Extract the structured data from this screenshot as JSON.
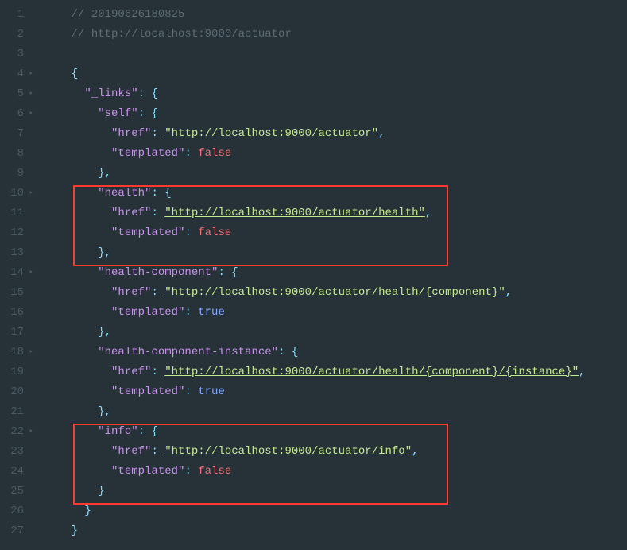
{
  "lines": {
    "l1": {
      "num": "1",
      "fold": "",
      "comment": "// 20190626180825"
    },
    "l2": {
      "num": "2",
      "fold": "",
      "comment": "// http://localhost:9000/actuator"
    },
    "l3": {
      "num": "3",
      "fold": ""
    },
    "l4": {
      "num": "4",
      "fold": "▾",
      "p1": "{"
    },
    "l5": {
      "num": "5",
      "fold": "▾",
      "k": "\"_links\"",
      "p1": ": ",
      "p2": "{"
    },
    "l6": {
      "num": "6",
      "fold": "▾",
      "k": "\"self\"",
      "p1": ": ",
      "p2": "{"
    },
    "l7": {
      "num": "7",
      "fold": "",
      "k": "\"href\"",
      "p1": ": ",
      "v": "\"http://localhost:9000/actuator\"",
      "p2": ","
    },
    "l8": {
      "num": "8",
      "fold": "",
      "k": "\"templated\"",
      "p1": ": ",
      "b": "false"
    },
    "l9": {
      "num": "9",
      "fold": "",
      "p1": "},",
      "cls": "c-punct"
    },
    "l10": {
      "num": "10",
      "fold": "▾",
      "k": "\"health\"",
      "p1": ": ",
      "p2": "{"
    },
    "l11": {
      "num": "11",
      "fold": "",
      "k": "\"href\"",
      "p1": ": ",
      "v": "\"http://localhost:9000/actuator/health\"",
      "p2": ","
    },
    "l12": {
      "num": "12",
      "fold": "",
      "k": "\"templated\"",
      "p1": ": ",
      "b": "false"
    },
    "l13": {
      "num": "13",
      "fold": "",
      "p1": "},",
      "cls": "c-punct"
    },
    "l14": {
      "num": "14",
      "fold": "▾",
      "k": "\"health-component\"",
      "p1": ": ",
      "p2": "{"
    },
    "l15": {
      "num": "15",
      "fold": "",
      "k": "\"href\"",
      "p1": ": ",
      "v": "\"http://localhost:9000/actuator/health/{component}\"",
      "p2": ","
    },
    "l16": {
      "num": "16",
      "fold": "",
      "k": "\"templated\"",
      "p1": ": ",
      "b": "true"
    },
    "l17": {
      "num": "17",
      "fold": "",
      "p1": "},",
      "cls": "c-punct"
    },
    "l18": {
      "num": "18",
      "fold": "▾",
      "k": "\"health-component-instance\"",
      "p1": ": ",
      "p2": "{"
    },
    "l19": {
      "num": "19",
      "fold": "",
      "k": "\"href\"",
      "p1": ": ",
      "v": "\"http://localhost:9000/actuator/health/{component}/{instance}\"",
      "p2": ","
    },
    "l20": {
      "num": "20",
      "fold": "",
      "k": "\"templated\"",
      "p1": ": ",
      "b": "true"
    },
    "l21": {
      "num": "21",
      "fold": "",
      "p1": "},",
      "cls": "c-punct"
    },
    "l22": {
      "num": "22",
      "fold": "▾",
      "k": "\"info\"",
      "p1": ": ",
      "p2": "{"
    },
    "l23": {
      "num": "23",
      "fold": "",
      "k": "\"href\"",
      "p1": ": ",
      "v": "\"http://localhost:9000/actuator/info\"",
      "p2": ","
    },
    "l24": {
      "num": "24",
      "fold": "",
      "k": "\"templated\"",
      "p1": ": ",
      "b": "false"
    },
    "l25": {
      "num": "25",
      "fold": "",
      "p1": "}",
      "cls": "c-punct"
    },
    "l26": {
      "num": "26",
      "fold": "",
      "p1": "}",
      "cls": "c-punct"
    },
    "l27": {
      "num": "27",
      "fold": "",
      "p1": "}",
      "cls": "c-punct"
    }
  }
}
